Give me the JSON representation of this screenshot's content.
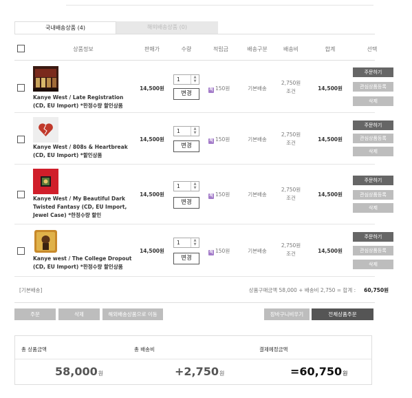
{
  "tabs": [
    {
      "label": "국내배송상품 (4)"
    },
    {
      "label": "해외배송상품 (0)"
    }
  ],
  "columns": {
    "product": "상품정보",
    "price": "판매가",
    "qty": "수량",
    "points": "적립금",
    "ship_type": "배송구분",
    "ship_fee": "배송비",
    "total": "합계",
    "select": "선택"
  },
  "items": [
    {
      "name": "Kanye West / Late Registration (CD, EU Import) *한정수량 할인상품",
      "price": "14,500원",
      "qty": "1",
      "change": "변경",
      "points": "150원",
      "ship_type": "기본배송",
      "fee": "2,750원",
      "fee_cond": "조건",
      "total": "14,500원",
      "btn_order": "주문하기",
      "btn_wish": "관심상품등록",
      "btn_delete": "삭제"
    },
    {
      "name": "Kanye West / 808s & Heartbreak (CD, EU Import) *할인상품",
      "price": "14,500원",
      "qty": "1",
      "change": "변경",
      "points": "150원",
      "ship_type": "기본배송",
      "fee": "2,750원",
      "fee_cond": "조건",
      "total": "14,500원",
      "btn_order": "주문하기",
      "btn_wish": "관심상품등록",
      "btn_delete": "삭제"
    },
    {
      "name": "Kanye West / My Beautiful Dark Twisted Fantasy (CD, EU Import, Jewel Case) *한정수량 할인",
      "price": "14,500원",
      "qty": "1",
      "change": "변경",
      "points": "150원",
      "ship_type": "기본배송",
      "fee": "2,750원",
      "fee_cond": "조건",
      "total": "14,500원",
      "btn_order": "주문하기",
      "btn_wish": "관심상품등록",
      "btn_delete": "삭제"
    },
    {
      "name": "Kanye west / The College Dropout (CD, EU Import) *한정수량 할인상품",
      "price": "14,500원",
      "qty": "1",
      "change": "변경",
      "points": "150원",
      "ship_type": "기본배송",
      "fee": "2,750원",
      "fee_cond": "조건",
      "total": "14,500원",
      "btn_order": "주문하기",
      "btn_wish": "관심상품등록",
      "btn_delete": "삭제"
    }
  ],
  "footer": {
    "basic_label": "[기본배송]",
    "total_text": "상품구매금액 58,000 + 배송비 2,750 = 합계 :",
    "total_value": "60,750원"
  },
  "actions": {
    "order": "주문",
    "delete": "삭제",
    "move_overseas": "해외배송상품으로 이동",
    "empty_cart": "장바구니비우기",
    "order_all": "전체상품주문"
  },
  "summary": {
    "product_total_label": "총 상품금액",
    "shipping_label": "총 배송비",
    "payment_label": "결제예정금액",
    "product_total": "58,000",
    "shipping": "+2,750",
    "payment": "=60,750",
    "unit": "원"
  },
  "colors": {
    "dark_button": "#666666",
    "light_button": "#bdbdbd",
    "points_badge": "#a37bc9"
  }
}
